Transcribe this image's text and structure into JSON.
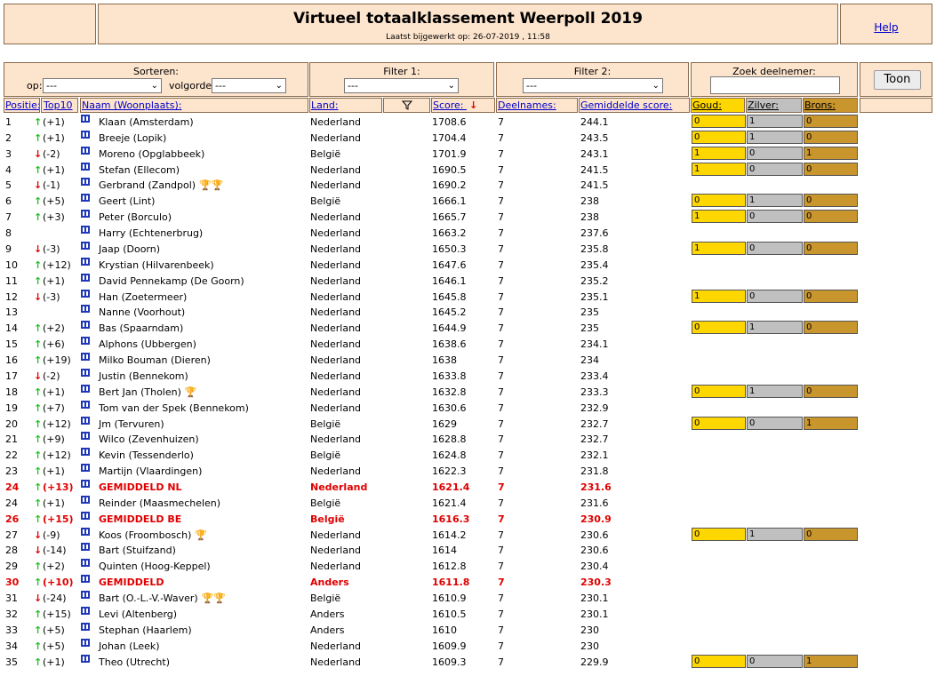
{
  "header": {
    "title": "Virtueel totaalklassement Weerpoll 2019",
    "subtitle": "Laatst bijgewerkt op: 26-07-2019 , 11:58",
    "help_label": "Help"
  },
  "controls": {
    "sort_label": "Sorteren:",
    "op_label": "op:",
    "op_value": "---",
    "order_label": "volgorde:",
    "order_value": "---",
    "filter1_label": "Filter 1:",
    "filter1_value": "---",
    "filter2_label": "Filter 2:",
    "filter2_value": "---",
    "search_label": "Zoek deelnemer:",
    "search_value": "",
    "toon_label": "Toon"
  },
  "columns": {
    "positie": "Positie:",
    "top10": "Top10",
    "naam": "Naam (Woonplaats):",
    "land": "Land:",
    "score": "Score:",
    "deelnames": "Deelnames:",
    "gemiddelde": "Gemiddelde score:",
    "goud": "Goud:",
    "zilver": "Zilver:",
    "brons": "Brons:"
  },
  "icons": {
    "filter": "filter-funnel-icon",
    "sort": "sort-down-arrow-icon",
    "up": "↑",
    "down": "↓",
    "trophy_gold": "🏆",
    "trophy_bronze": "🏆"
  },
  "colors": {
    "panel": "#fde4cd",
    "gold": "#ffd700",
    "silver": "#c0c0c0",
    "bronze": "#c9962e",
    "highlight": "#e00000",
    "up": "#1dc21d"
  },
  "rows": [
    {
      "pos": "1",
      "dir": "up",
      "change": "(+1)",
      "name": "Klaan (Amsterdam)",
      "trophies": "",
      "tcolor": "",
      "land": "Nederland",
      "score": "1708.6",
      "deel": "7",
      "avg": "244.1",
      "medals": [
        "0",
        "1",
        "0"
      ],
      "red": false
    },
    {
      "pos": "2",
      "dir": "up",
      "change": "(+1)",
      "name": "Breeje (Lopik)",
      "trophies": "",
      "tcolor": "",
      "land": "Nederland",
      "score": "1704.4",
      "deel": "7",
      "avg": "243.5",
      "medals": [
        "0",
        "1",
        "0"
      ],
      "red": false
    },
    {
      "pos": "3",
      "dir": "down",
      "change": "(-2)",
      "name": "Moreno (Opglabbeek)",
      "trophies": "",
      "tcolor": "",
      "land": "België",
      "score": "1701.9",
      "deel": "7",
      "avg": "243.1",
      "medals": [
        "1",
        "0",
        "1"
      ],
      "red": false
    },
    {
      "pos": "4",
      "dir": "up",
      "change": "(+1)",
      "name": "Stefan (Ellecom)",
      "trophies": "",
      "tcolor": "",
      "land": "Nederland",
      "score": "1690.5",
      "deel": "7",
      "avg": "241.5",
      "medals": [
        "1",
        "0",
        "0"
      ],
      "red": false
    },
    {
      "pos": "5",
      "dir": "down",
      "change": "(-1)",
      "name": "Gerbrand (Zandpol)",
      "trophies": "🏆🏆",
      "tcolor": "#b8742a",
      "land": "Nederland",
      "score": "1690.2",
      "deel": "7",
      "avg": "241.5",
      "medals": null,
      "red": false
    },
    {
      "pos": "6",
      "dir": "up",
      "change": "(+5)",
      "name": "Geert (Lint)",
      "trophies": "",
      "tcolor": "",
      "land": "België",
      "score": "1666.1",
      "deel": "7",
      "avg": "238",
      "medals": [
        "0",
        "1",
        "0"
      ],
      "red": false
    },
    {
      "pos": "7",
      "dir": "up",
      "change": "(+3)",
      "name": "Peter (Borculo)",
      "trophies": "",
      "tcolor": "",
      "land": "Nederland",
      "score": "1665.7",
      "deel": "7",
      "avg": "238",
      "medals": [
        "1",
        "0",
        "0"
      ],
      "red": false
    },
    {
      "pos": "8",
      "dir": "",
      "change": "",
      "name": "Harry (Echtenerbrug)",
      "trophies": "",
      "tcolor": "",
      "land": "Nederland",
      "score": "1663.2",
      "deel": "7",
      "avg": "237.6",
      "medals": null,
      "red": false
    },
    {
      "pos": "9",
      "dir": "down",
      "change": "(-3)",
      "name": "Jaap (Doorn)",
      "trophies": "",
      "tcolor": "",
      "land": "Nederland",
      "score": "1650.3",
      "deel": "7",
      "avg": "235.8",
      "medals": [
        "1",
        "0",
        "0"
      ],
      "red": false
    },
    {
      "pos": "10",
      "dir": "up",
      "change": "(+12)",
      "name": "Krystian (Hilvarenbeek)",
      "trophies": "",
      "tcolor": "",
      "land": "Nederland",
      "score": "1647.6",
      "deel": "7",
      "avg": "235.4",
      "medals": null,
      "red": false
    },
    {
      "pos": "11",
      "dir": "up",
      "change": "(+1)",
      "name": "David Pennekamp (De Goorn)",
      "trophies": "",
      "tcolor": "",
      "land": "Nederland",
      "score": "1646.1",
      "deel": "7",
      "avg": "235.2",
      "medals": null,
      "red": false
    },
    {
      "pos": "12",
      "dir": "down",
      "change": "(-3)",
      "name": "Han (Zoetermeer)",
      "trophies": "",
      "tcolor": "",
      "land": "Nederland",
      "score": "1645.8",
      "deel": "7",
      "avg": "235.1",
      "medals": [
        "1",
        "0",
        "0"
      ],
      "red": false
    },
    {
      "pos": "13",
      "dir": "",
      "change": "",
      "name": "Nanne (Voorhout)",
      "trophies": "",
      "tcolor": "",
      "land": "Nederland",
      "score": "1645.2",
      "deel": "7",
      "avg": "235",
      "medals": null,
      "red": false
    },
    {
      "pos": "14",
      "dir": "up",
      "change": "(+2)",
      "name": "Bas (Spaarndam)",
      "trophies": "",
      "tcolor": "",
      "land": "Nederland",
      "score": "1644.9",
      "deel": "7",
      "avg": "235",
      "medals": [
        "0",
        "1",
        "0"
      ],
      "red": false
    },
    {
      "pos": "15",
      "dir": "up",
      "change": "(+6)",
      "name": "Alphons (Ubbergen)",
      "trophies": "",
      "tcolor": "",
      "land": "Nederland",
      "score": "1638.6",
      "deel": "7",
      "avg": "234.1",
      "medals": null,
      "red": false
    },
    {
      "pos": "16",
      "dir": "up",
      "change": "(+19)",
      "name": "Milko Bouman (Dieren)",
      "trophies": "",
      "tcolor": "",
      "land": "Nederland",
      "score": "1638",
      "deel": "7",
      "avg": "234",
      "medals": null,
      "red": false
    },
    {
      "pos": "17",
      "dir": "down",
      "change": "(-2)",
      "name": "Justin (Bennekom)",
      "trophies": "",
      "tcolor": "",
      "land": "Nederland",
      "score": "1633.8",
      "deel": "7",
      "avg": "233.4",
      "medals": null,
      "red": false
    },
    {
      "pos": "18",
      "dir": "up",
      "change": "(+1)",
      "name": "Bert Jan (Tholen)",
      "trophies": "🏆",
      "tcolor": "#b8742a",
      "land": "Nederland",
      "score": "1632.8",
      "deel": "7",
      "avg": "233.3",
      "medals": [
        "0",
        "1",
        "0"
      ],
      "red": false
    },
    {
      "pos": "19",
      "dir": "up",
      "change": "(+7)",
      "name": "Tom van der Spek (Bennekom)",
      "trophies": "",
      "tcolor": "",
      "land": "Nederland",
      "score": "1630.6",
      "deel": "7",
      "avg": "232.9",
      "medals": null,
      "red": false
    },
    {
      "pos": "20",
      "dir": "up",
      "change": "(+12)",
      "name": "Jm (Tervuren)",
      "trophies": "",
      "tcolor": "",
      "land": "België",
      "score": "1629",
      "deel": "7",
      "avg": "232.7",
      "medals": [
        "0",
        "0",
        "1"
      ],
      "red": false
    },
    {
      "pos": "21",
      "dir": "up",
      "change": "(+9)",
      "name": "Wilco (Zevenhuizen)",
      "trophies": "",
      "tcolor": "",
      "land": "Nederland",
      "score": "1628.8",
      "deel": "7",
      "avg": "232.7",
      "medals": null,
      "red": false
    },
    {
      "pos": "22",
      "dir": "up",
      "change": "(+12)",
      "name": "Kevin (Tessenderlo)",
      "trophies": "",
      "tcolor": "",
      "land": "België",
      "score": "1624.8",
      "deel": "7",
      "avg": "232.1",
      "medals": null,
      "red": false
    },
    {
      "pos": "23",
      "dir": "up",
      "change": "(+1)",
      "name": "Martijn (Vlaardingen)",
      "trophies": "",
      "tcolor": "",
      "land": "Nederland",
      "score": "1622.3",
      "deel": "7",
      "avg": "231.8",
      "medals": null,
      "red": false
    },
    {
      "pos": "24",
      "dir": "up",
      "change": "(+13)",
      "name": "GEMIDDELD NL",
      "trophies": "",
      "tcolor": "",
      "land": "Nederland",
      "score": "1621.4",
      "deel": "7",
      "avg": "231.6",
      "medals": null,
      "red": true
    },
    {
      "pos": "24",
      "dir": "up",
      "change": "(+1)",
      "name": "Reinder (Maasmechelen)",
      "trophies": "",
      "tcolor": "",
      "land": "België",
      "score": "1621.4",
      "deel": "7",
      "avg": "231.6",
      "medals": null,
      "red": false
    },
    {
      "pos": "26",
      "dir": "up",
      "change": "(+15)",
      "name": "GEMIDDELD BE",
      "trophies": "",
      "tcolor": "",
      "land": "België",
      "score": "1616.3",
      "deel": "7",
      "avg": "230.9",
      "medals": null,
      "red": true
    },
    {
      "pos": "27",
      "dir": "down",
      "change": "(-9)",
      "name": "Koos (Froombosch)",
      "trophies": "🏆",
      "tcolor": "#d9c400",
      "land": "Nederland",
      "score": "1614.2",
      "deel": "7",
      "avg": "230.6",
      "medals": [
        "0",
        "1",
        "0"
      ],
      "red": false
    },
    {
      "pos": "28",
      "dir": "down",
      "change": "(-14)",
      "name": "Bart (Stuifzand)",
      "trophies": "",
      "tcolor": "",
      "land": "Nederland",
      "score": "1614",
      "deel": "7",
      "avg": "230.6",
      "medals": null,
      "red": false
    },
    {
      "pos": "29",
      "dir": "up",
      "change": "(+2)",
      "name": "Quinten (Hoog-Keppel)",
      "trophies": "",
      "tcolor": "",
      "land": "Nederland",
      "score": "1612.8",
      "deel": "7",
      "avg": "230.4",
      "medals": null,
      "red": false
    },
    {
      "pos": "30",
      "dir": "up",
      "change": "(+10)",
      "name": "GEMIDDELD",
      "trophies": "",
      "tcolor": "",
      "land": "Anders",
      "score": "1611.8",
      "deel": "7",
      "avg": "230.3",
      "medals": null,
      "red": true
    },
    {
      "pos": "31",
      "dir": "down",
      "change": "(-24)",
      "name": "Bart (O.-L.-V.-Waver)",
      "trophies": "🏆🏆",
      "tcolor": "#d9c400",
      "land": "België",
      "score": "1610.9",
      "deel": "7",
      "avg": "230.1",
      "medals": null,
      "red": false
    },
    {
      "pos": "32",
      "dir": "up",
      "change": "(+15)",
      "name": "Levi (Altenberg)",
      "trophies": "",
      "tcolor": "",
      "land": "Anders",
      "score": "1610.5",
      "deel": "7",
      "avg": "230.1",
      "medals": null,
      "red": false
    },
    {
      "pos": "33",
      "dir": "up",
      "change": "(+5)",
      "name": "Stephan (Haarlem)",
      "trophies": "",
      "tcolor": "",
      "land": "Anders",
      "score": "1610",
      "deel": "7",
      "avg": "230",
      "medals": null,
      "red": false
    },
    {
      "pos": "34",
      "dir": "up",
      "change": "(+5)",
      "name": "Johan (Leek)",
      "trophies": "",
      "tcolor": "",
      "land": "Nederland",
      "score": "1609.9",
      "deel": "7",
      "avg": "230",
      "medals": null,
      "red": false
    },
    {
      "pos": "35",
      "dir": "up",
      "change": "(+1)",
      "name": "Theo (Utrecht)",
      "trophies": "",
      "tcolor": "",
      "land": "Nederland",
      "score": "1609.3",
      "deel": "7",
      "avg": "229.9",
      "medals": [
        "0",
        "0",
        "1"
      ],
      "red": false
    }
  ]
}
